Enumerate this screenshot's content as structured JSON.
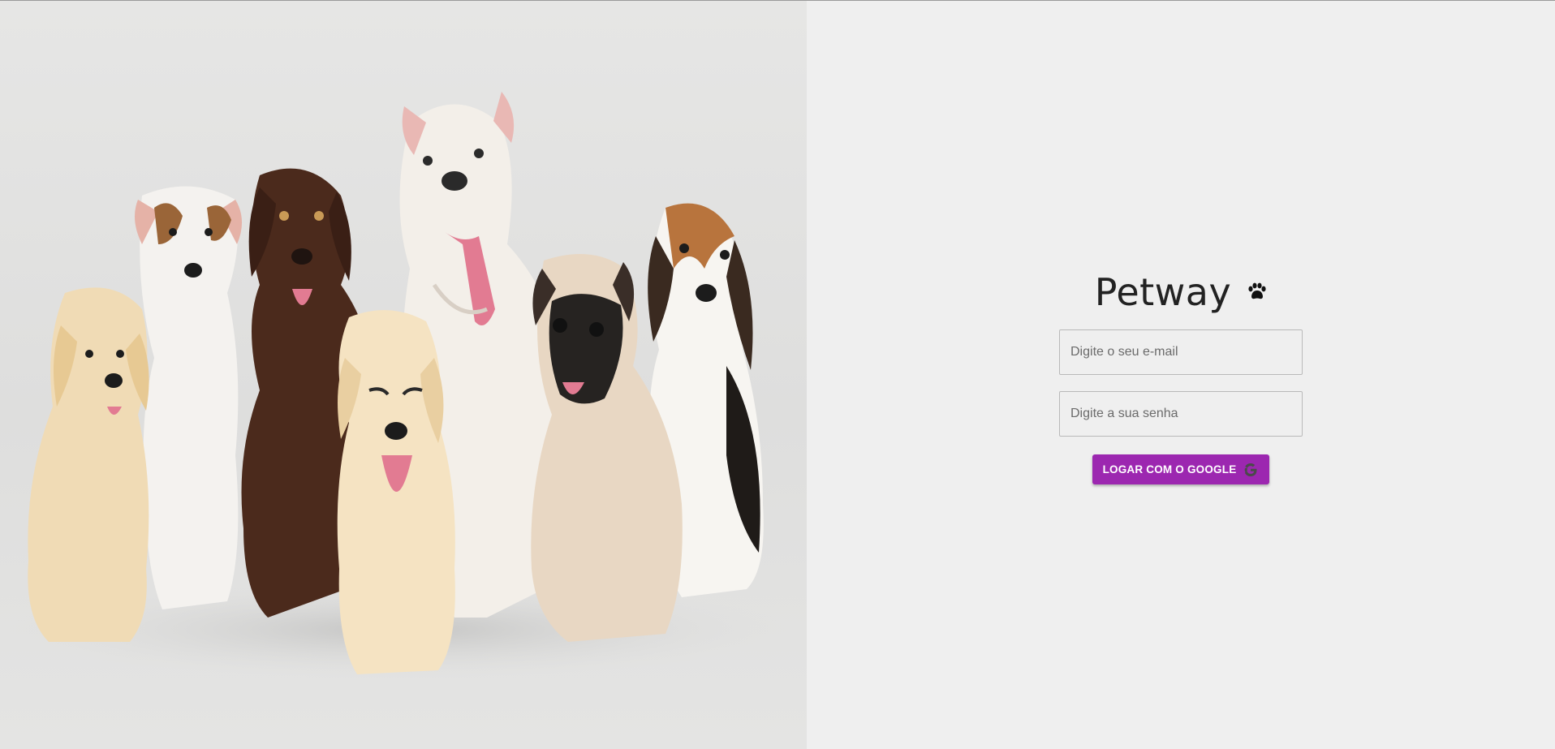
{
  "hero": {
    "image": "group-of-puppies-photo",
    "background": "#e3e3e2"
  },
  "brand": {
    "title": "Petway",
    "icon": "paw-icon"
  },
  "form": {
    "email_placeholder": "Digite o seu e-mail",
    "password_placeholder": "Digite a sua senha",
    "google_button_label": "LOGAR COM O GOOGLE",
    "google_icon": "google-icon"
  },
  "colors": {
    "accent": "#9c27b0",
    "panel_background": "#efefef",
    "title_text": "#222222"
  }
}
